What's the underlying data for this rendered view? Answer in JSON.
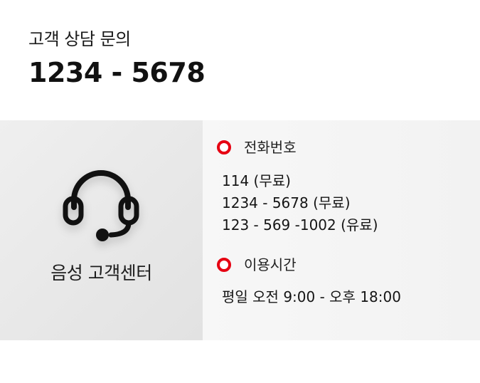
{
  "header": {
    "title": "고객 상담 문의",
    "number": "1234 - 5678"
  },
  "center": {
    "icon": "headset-icon",
    "label": "음성 고객센터"
  },
  "phone": {
    "title": "전화번호",
    "lines": [
      "114 (무료)",
      "1234 - 5678 (무료)",
      "123 - 569 -1002 (유료)"
    ]
  },
  "hours": {
    "title": "이용시간",
    "lines": [
      "평일 오전 9:00 - 오후 18:00"
    ]
  },
  "colors": {
    "accent": "#e60012",
    "left_panel": "#e8e8e8",
    "right_panel": "#f4f4f4"
  }
}
